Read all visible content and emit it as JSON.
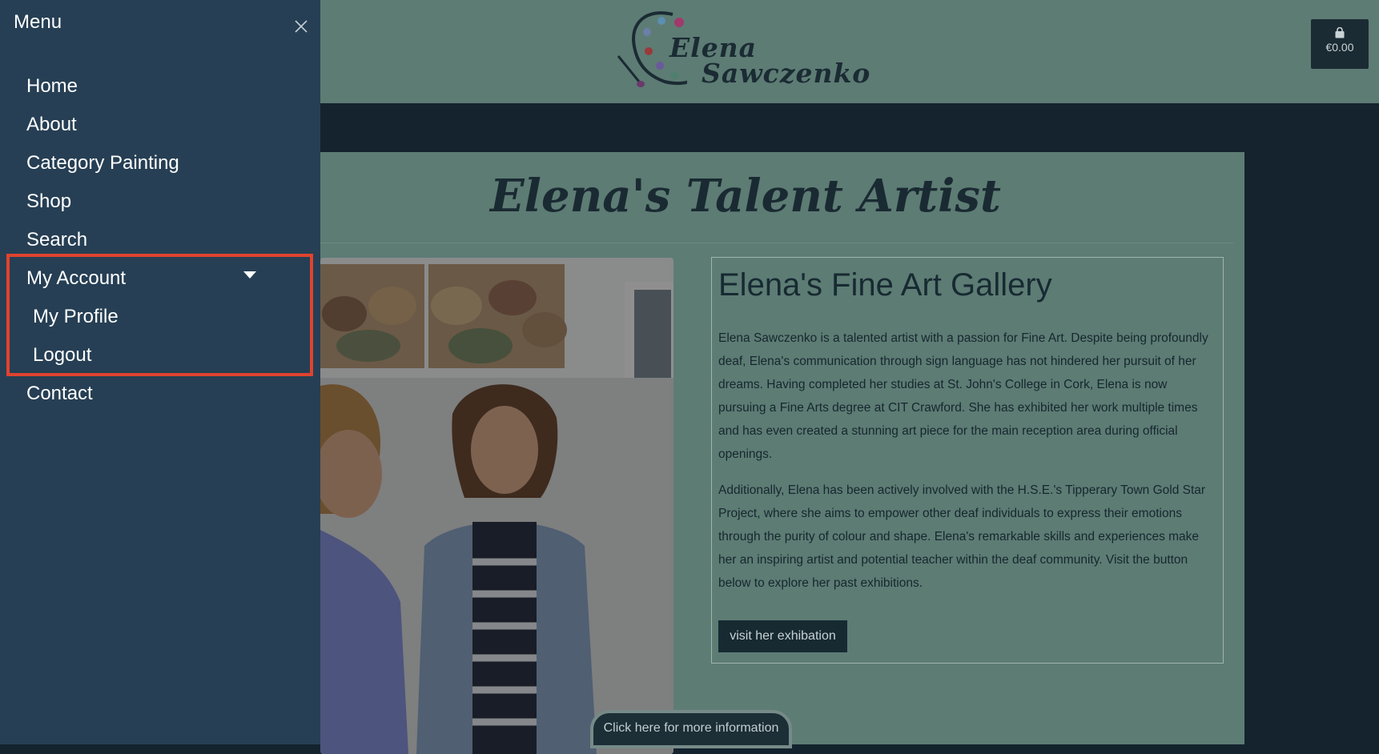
{
  "header": {
    "logo_line1": "Elena",
    "logo_line2": "Sawczenko",
    "cart_total": "€0.00"
  },
  "side_menu": {
    "title": "Menu",
    "items": [
      {
        "label": "Home"
      },
      {
        "label": "About"
      },
      {
        "label": "Category Painting"
      },
      {
        "label": "Shop"
      },
      {
        "label": "Search"
      },
      {
        "label": "My Account",
        "expanded": true,
        "children": [
          {
            "label": "My Profile"
          },
          {
            "label": "Logout"
          }
        ]
      },
      {
        "label": "Contact"
      }
    ],
    "highlight_color": "#e0432f"
  },
  "main": {
    "page_title": "Elena's Talent Artist",
    "gallery_title": "Elena's Fine Art Gallery",
    "paragraph_1": "Elena Sawczenko is a talented artist with a passion for Fine Art. Despite being profoundly deaf, Elena's communication through sign language has not hindered her pursuit of her dreams. Having completed her studies at St. John's College in Cork, Elena is now pursuing a Fine Arts degree at CIT Crawford. She has exhibited her work multiple times and has even created a stunning art piece for the main reception area during official openings.",
    "paragraph_2": "Additionally, Elena has been actively involved with the H.S.E.'s Tipperary Town Gold Star Project, where she aims to empower other deaf individuals to express their emotions through the purity of colour and shape. Elena's remarkable skills and experiences make her an inspiring artist and potential teacher within the deaf community. Visit the button below to explore her past exhibitions.",
    "exhibition_button": "visit her exhibation",
    "info_button": "Click here for more information"
  },
  "colors": {
    "header_bg": "#5d7c74",
    "menu_bg": "#263f54",
    "page_bg": "#14232e",
    "dark_button": "#172a32"
  }
}
